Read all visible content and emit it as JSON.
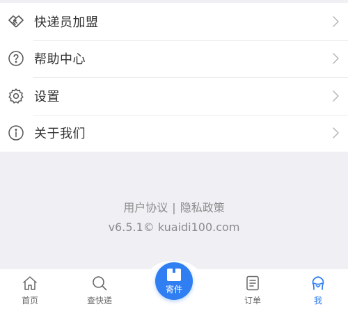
{
  "menu": {
    "items": [
      {
        "label": "快递员加盟",
        "icon": "handshake-icon"
      },
      {
        "label": "帮助中心",
        "icon": "help-icon"
      },
      {
        "label": "设置",
        "icon": "gear-icon"
      },
      {
        "label": "关于我们",
        "icon": "info-icon"
      }
    ]
  },
  "footer": {
    "user_agreement": "用户协议",
    "separator": "|",
    "privacy_policy": "隐私政策",
    "version": "v6.5.1© kuaidi100.com"
  },
  "tabbar": {
    "home": "首页",
    "track": "查快递",
    "send": "寄件",
    "orders": "订单",
    "me": "我",
    "active": "me",
    "accent_color": "#2f7ef2"
  }
}
